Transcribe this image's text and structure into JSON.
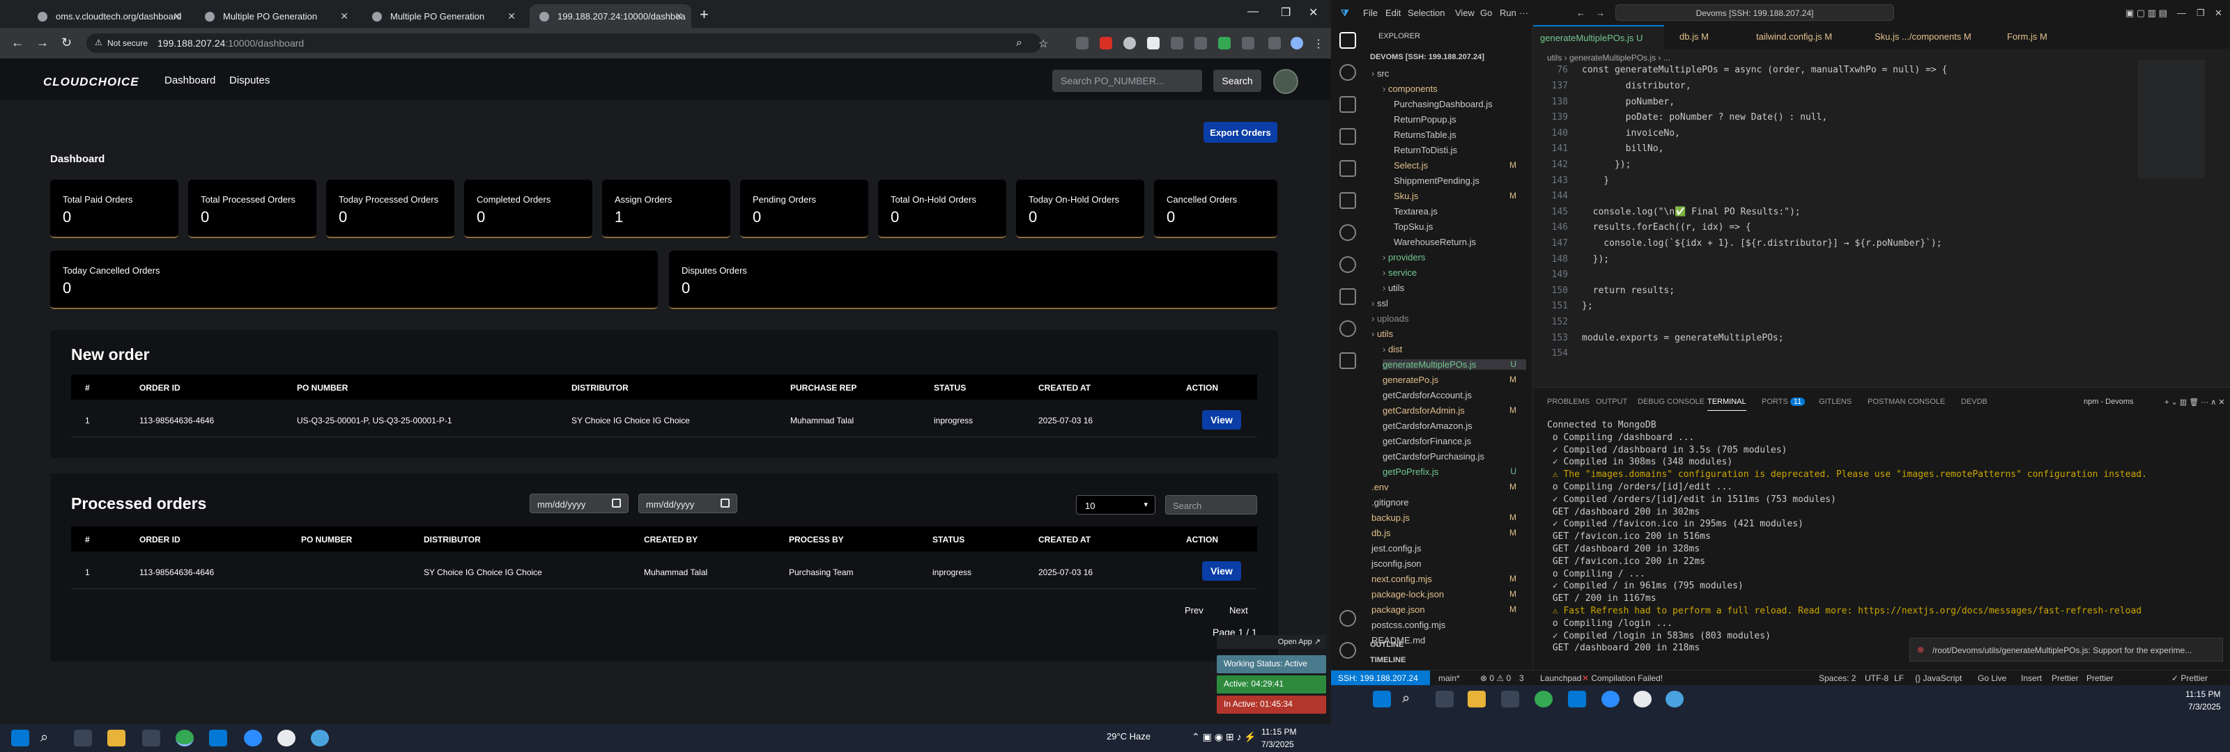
{
  "browser": {
    "tabs": [
      {
        "title": "oms.v.cloudtech.org/dashboard"
      },
      {
        "title": "Multiple PO Generation"
      },
      {
        "title": "Multiple PO Generation"
      },
      {
        "title": "199.188.207.24:10000/dashboa"
      }
    ],
    "not_secure": "Not secure",
    "url_host": "199.188.207.24",
    "url_path": ":10000/dashboard"
  },
  "app": {
    "logo": "CLOUDCHOICE",
    "nav": {
      "dashboard": "Dashboard",
      "disputes": "Disputes"
    },
    "search_placeholder": "Search PO_NUMBER...",
    "search_button": "Search",
    "page_title": "Dashboard",
    "export_button": "Export Orders",
    "cards": [
      {
        "title": "Total Paid Orders",
        "value": "0"
      },
      {
        "title": "Total Processed Orders",
        "value": "0"
      },
      {
        "title": "Today Processed Orders",
        "value": "0"
      },
      {
        "title": "Completed Orders",
        "value": "0"
      },
      {
        "title": "Assign Orders",
        "value": "1"
      },
      {
        "title": "Pending Orders",
        "value": "0"
      },
      {
        "title": "Total On-Hold Orders",
        "value": "0"
      },
      {
        "title": "Today On-Hold Orders",
        "value": "0"
      },
      {
        "title": "Cancelled Orders",
        "value": "0"
      },
      {
        "title": "Today Cancelled Orders",
        "value": "0"
      },
      {
        "title": "Disputes Orders",
        "value": "0"
      }
    ],
    "new_order": {
      "title": "New order",
      "headers": [
        "#",
        "ORDER ID",
        "PO NUMBER",
        "DISTRIBUTOR",
        "PURCHASE REP",
        "STATUS",
        "CREATED AT",
        "ACTION"
      ],
      "rows": [
        {
          "num": "1",
          "order_id": "113-98564636-4646",
          "po_number": "US-Q3-25-00001-P, US-Q3-25-00001-P-1",
          "distributor": "SY Choice IG Choice IG Choice",
          "rep": "Muhammad Talal",
          "status": "inprogress",
          "created": "2025-07-03 16",
          "action": "View"
        }
      ]
    },
    "processed": {
      "title": "Processed orders",
      "date_placeholder_1": "mm/dd/yyyy",
      "date_placeholder_2": "mm/dd/yyyy",
      "page_size": "10",
      "filter_placeholder": "Search",
      "headers": [
        "#",
        "ORDER ID",
        "PO NUMBER",
        "DISTRIBUTOR",
        "CREATED BY",
        "PROCESS BY",
        "STATUS",
        "CREATED AT",
        "ACTION"
      ],
      "rows": [
        {
          "num": "1",
          "order_id": "113-98564636-4646",
          "po_number": "",
          "distributor": "SY Choice IG Choice IG Choice",
          "created_by": "Muhammad Talal",
          "process_by": "Purchasing Team",
          "status": "inprogress",
          "created": "2025-07-03 16",
          "action": "View"
        }
      ],
      "prev": "Prev",
      "next": "Next",
      "page_info": "Page 1 / 1"
    },
    "overlay": {
      "open_app": "Open App ↗",
      "working": "Working Status: Active",
      "active": "Active: 04:29:41",
      "inactive": "In Active: 01:45:34"
    }
  },
  "taskbar_left": {
    "weather": "29°C  Haze",
    "time": "11:15 PM",
    "date": "7/3/2025"
  },
  "vscode": {
    "menu": [
      "File",
      "Edit",
      "Selection",
      "View",
      "Go",
      "Run"
    ],
    "command_center": "Devoms [SSH: 199.188.207.24]",
    "explorer_title": "EXPLORER",
    "root": "DEVOMS [SSH: 199.188.207.24]",
    "tree": [
      {
        "name": "src",
        "indent": 0,
        "color": "#ccc",
        "badge": "",
        "folder": true
      },
      {
        "name": "components",
        "indent": 1,
        "color": "#e2c08d",
        "badge": "",
        "folder": true
      },
      {
        "name": "PurchasingDashboard.js",
        "indent": 2,
        "color": "#ccc",
        "badge": ""
      },
      {
        "name": "ReturnPopup.js",
        "indent": 2,
        "color": "#ccc",
        "badge": ""
      },
      {
        "name": "ReturnsTable.js",
        "indent": 2,
        "color": "#ccc",
        "badge": ""
      },
      {
        "name": "ReturnToDisti.js",
        "indent": 2,
        "color": "#ccc",
        "badge": ""
      },
      {
        "name": "Select.js",
        "indent": 2,
        "color": "#e2c08d",
        "badge": "M"
      },
      {
        "name": "ShippmentPending.js",
        "indent": 2,
        "color": "#ccc",
        "badge": ""
      },
      {
        "name": "Sku.js",
        "indent": 2,
        "color": "#e2c08d",
        "badge": "M"
      },
      {
        "name": "Textarea.js",
        "indent": 2,
        "color": "#ccc",
        "badge": ""
      },
      {
        "name": "TopSku.js",
        "indent": 2,
        "color": "#ccc",
        "badge": ""
      },
      {
        "name": "WarehouseReturn.js",
        "indent": 2,
        "color": "#ccc",
        "badge": ""
      },
      {
        "name": "providers",
        "indent": 1,
        "color": "#73c991",
        "badge": "",
        "folder": true
      },
      {
        "name": "service",
        "indent": 1,
        "color": "#73c991",
        "badge": "",
        "folder": true
      },
      {
        "name": "utils",
        "indent": 1,
        "color": "#ccc",
        "badge": "",
        "folder": true
      },
      {
        "name": "ssl",
        "indent": 0,
        "color": "#ccc",
        "badge": "",
        "folder": true
      },
      {
        "name": "uploads",
        "indent": 0,
        "color": "#8c8c8c",
        "badge": "",
        "folder": true
      },
      {
        "name": "utils",
        "indent": 0,
        "color": "#e2c08d",
        "badge": "",
        "folder": true
      },
      {
        "name": "dist",
        "indent": 1,
        "color": "#e2c08d",
        "badge": "",
        "folder": true
      },
      {
        "name": "generateMultiplePOs.js",
        "indent": 1,
        "color": "#73c991",
        "badge": "U"
      },
      {
        "name": "generatePo.js",
        "indent": 1,
        "color": "#e2c08d",
        "badge": "M"
      },
      {
        "name": "getCardsforAccount.js",
        "indent": 1,
        "color": "#ccc",
        "badge": ""
      },
      {
        "name": "getCardsforAdmin.js",
        "indent": 1,
        "color": "#e2c08d",
        "badge": "M"
      },
      {
        "name": "getCardsforAmazon.js",
        "indent": 1,
        "color": "#ccc",
        "badge": ""
      },
      {
        "name": "getCardsforFinance.js",
        "indent": 1,
        "color": "#ccc",
        "badge": ""
      },
      {
        "name": "getCardsforPurchasing.js",
        "indent": 1,
        "color": "#ccc",
        "badge": ""
      },
      {
        "name": "getPoPrefix.js",
        "indent": 1,
        "color": "#73c991",
        "badge": "U"
      },
      {
        "name": ".env",
        "indent": 0,
        "color": "#e2c08d",
        "badge": "M"
      },
      {
        "name": ".gitignore",
        "indent": 0,
        "color": "#ccc",
        "badge": ""
      },
      {
        "name": "backup.js",
        "indent": 0,
        "color": "#e2c08d",
        "badge": "M"
      },
      {
        "name": "db.js",
        "indent": 0,
        "color": "#e2c08d",
        "badge": "M"
      },
      {
        "name": "jest.config.js",
        "indent": 0,
        "color": "#ccc",
        "badge": ""
      },
      {
        "name": "jsconfig.json",
        "indent": 0,
        "color": "#ccc",
        "badge": ""
      },
      {
        "name": "next.config.mjs",
        "indent": 0,
        "color": "#e2c08d",
        "badge": "M"
      },
      {
        "name": "package-lock.json",
        "indent": 0,
        "color": "#e2c08d",
        "badge": "M"
      },
      {
        "name": "package.json",
        "indent": 0,
        "color": "#e2c08d",
        "badge": "M"
      },
      {
        "name": "postcss.config.mjs",
        "indent": 0,
        "color": "#ccc",
        "badge": ""
      },
      {
        "name": "README.md",
        "indent": 0,
        "color": "#ccc",
        "badge": ""
      }
    ],
    "outline": "OUTLINE",
    "timeline": "TIMELINE",
    "editor_tabs": [
      {
        "name": "generateMultiplePOs.js",
        "badge": "U"
      },
      {
        "name": "db.js",
        "badge": "M"
      },
      {
        "name": "tailwind.config.js",
        "badge": "M"
      },
      {
        "name": "Sku.js  .../components",
        "badge": "M"
      },
      {
        "name": "Form.js",
        "badge": "M"
      }
    ],
    "breadcrumb": "utils  ›  generateMultiplePOs.js  ›  ...",
    "sticky_line": {
      "n": "76",
      "code": "const generateMultiplePOs = async (order, manualTxwhPo = null) => {"
    },
    "code_lines": [
      {
        "n": "137",
        "code": "        distributor,"
      },
      {
        "n": "138",
        "code": "        poNumber,"
      },
      {
        "n": "139",
        "code": "        poDate: poNumber ? new Date() : null,"
      },
      {
        "n": "140",
        "code": "        invoiceNo,"
      },
      {
        "n": "141",
        "code": "        billNo,"
      },
      {
        "n": "142",
        "code": "      });"
      },
      {
        "n": "143",
        "code": "    }"
      },
      {
        "n": "144",
        "code": ""
      },
      {
        "n": "145",
        "code": "  console.log(\"\\n✅ Final PO Results:\");"
      },
      {
        "n": "146",
        "code": "  results.forEach((r, idx) => {"
      },
      {
        "n": "147",
        "code": "    console.log(`${idx + 1}. [${r.distributor}] → ${r.poNumber}`);"
      },
      {
        "n": "148",
        "code": "  });"
      },
      {
        "n": "149",
        "code": ""
      },
      {
        "n": "150",
        "code": "  return results;"
      },
      {
        "n": "151",
        "code": "};"
      },
      {
        "n": "152",
        "code": ""
      },
      {
        "n": "153",
        "code": "module.exports = generateMultiplePOs;"
      },
      {
        "n": "154",
        "code": ""
      }
    ],
    "panel_tabs": [
      "PROBLEMS",
      "OUTPUT",
      "DEBUG CONSOLE",
      "TERMINAL",
      "PORTS",
      "GITLENS",
      "POSTMAN CONSOLE",
      "DEVDB"
    ],
    "ports_badge": "11",
    "terminal_name": "npm - Devoms",
    "terminal_lines": [
      "Connected to MongoDB",
      " o Compiling /dashboard ...",
      " ✓ Compiled /dashboard in 3.5s (705 modules)",
      " ✓ Compiled in 308ms (348 modules)",
      " ⚠ The \"images.domains\" configuration is deprecated. Please use \"images.remotePatterns\" configuration instead.",
      " o Compiling /orders/[id]/edit ...",
      " ✓ Compiled /orders/[id]/edit in 1511ms (753 modules)",
      " GET /dashboard 200 in 302ms",
      " ✓ Compiled /favicon.ico in 295ms (421 modules)",
      " GET /favicon.ico 200 in 516ms",
      " GET /dashboard 200 in 328ms",
      " GET /favicon.ico 200 in 22ms",
      " o Compiling / ...",
      " ✓ Compiled / in 961ms (795 modules)",
      " GET / 200 in 1167ms",
      " ⚠ Fast Refresh had to perform a full reload. Read more: https://nextjs.org/docs/messages/fast-refresh-reload",
      " o Compiling /login ...",
      " ✓ Compiled /login in 583ms (803 modules)",
      " GET /dashboard 200 in 218ms"
    ],
    "toast": "/root/Devoms/utils/generateMultiplePOs.js: Support for the experime...",
    "status": {
      "remote": "SSH: 199.188.207.24",
      "branch": "main*",
      "problems": "⊗ 0 ⚠ 0",
      "ports": "3",
      "launchpad": "Launchpad",
      "compile": "Compilation Failed!",
      "spaces": "Spaces: 2",
      "encoding": "UTF-8",
      "eol": "LF",
      "lang": "{} JavaScript",
      "golive": "Go Live",
      "insert": "Insert",
      "prettier1": "Prettier",
      "prettier2": "Prettier",
      "prettier3": "✓ Prettier"
    },
    "taskbar_time": "11:15 PM",
    "taskbar_date": "7/3/2025"
  }
}
